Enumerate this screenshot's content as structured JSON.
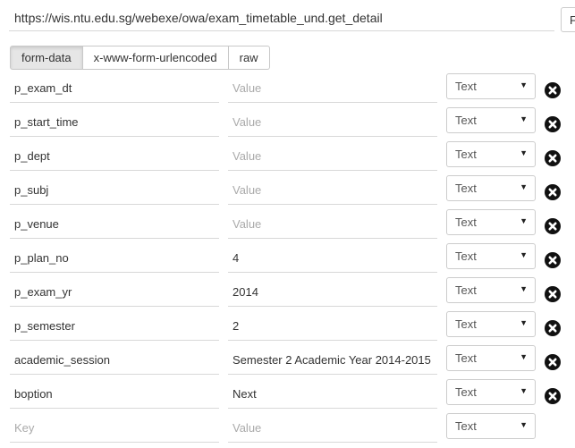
{
  "request": {
    "url": "https://wis.ntu.edu.sg/webexe/owa/exam_timetable_und.get_detail",
    "side_button_label": "F"
  },
  "body_tabs": [
    {
      "label": "form-data",
      "active": true
    },
    {
      "label": "x-www-form-urlencoded",
      "active": false
    },
    {
      "label": "raw",
      "active": false
    }
  ],
  "params": [
    {
      "key": "p_exam_dt",
      "value": "",
      "type": "Text"
    },
    {
      "key": "p_start_time",
      "value": "",
      "type": "Text"
    },
    {
      "key": "p_dept",
      "value": "",
      "type": "Text"
    },
    {
      "key": "p_subj",
      "value": "",
      "type": "Text"
    },
    {
      "key": "p_venue",
      "value": "",
      "type": "Text"
    },
    {
      "key": "p_plan_no",
      "value": "4",
      "type": "Text"
    },
    {
      "key": "p_exam_yr",
      "value": "2014",
      "type": "Text"
    },
    {
      "key": "p_semester",
      "value": "2",
      "type": "Text"
    },
    {
      "key": "academic_session",
      "value": "Semester 2 Academic Year 2014-2015",
      "type": "Text"
    },
    {
      "key": "boption",
      "value": "Next",
      "type": "Text"
    }
  ],
  "new_row": {
    "key_placeholder": "Key",
    "value_placeholder": "Value",
    "type": "Text"
  },
  "placeholders": {
    "value": "Value"
  },
  "icons": {
    "dropdown": "caret-down-icon",
    "remove": "close-circle-icon"
  },
  "colors": {
    "active_tab_bg": "#e6e6e6",
    "remove_icon": "#111111",
    "placeholder_text": "#aaaaaa"
  }
}
